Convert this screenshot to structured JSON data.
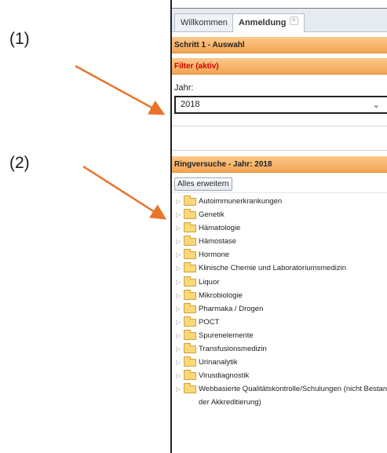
{
  "annotations": {
    "marker_1": "(1)",
    "marker_2": "(2)",
    "arrow_color": "#e8742a"
  },
  "tabs": [
    {
      "label": "Willkommen",
      "active": false
    },
    {
      "label": "Anmeldung",
      "active": true,
      "close_icon": "close-icon"
    }
  ],
  "step_header": "Schritt 1 - Auswahl",
  "filter": {
    "header": "Filter (aktiv)",
    "header_color": "#d40000",
    "year_label": "Jahr:",
    "year_value": "2018",
    "dropdown_icon": "chevron-down-icon"
  },
  "ringversuche": {
    "header": "Ringversuche - Jahr: 2018",
    "expand_all_label": "Alles erweitern",
    "items": [
      "Autoimmunerkrankungen",
      "Genetik",
      "Hämatologie",
      "Hämostase",
      "Hormone",
      "Klinische Chemie und Laboratoriumsmedizin",
      "Liquor",
      "Mikrobiologie",
      "Pharmaka / Drogen",
      "POCT",
      "Spurenelemente",
      "Transfusionsmedizin",
      "Urinanalytik",
      "Virusdiagnostik",
      "Webbasierte Qualitätskontrolle/Schulungen (nicht Bestandteil der Akkreditierung)"
    ]
  },
  "colors": {
    "band_orange": "#f2a454",
    "folder_yellow": "#f9d87a"
  }
}
